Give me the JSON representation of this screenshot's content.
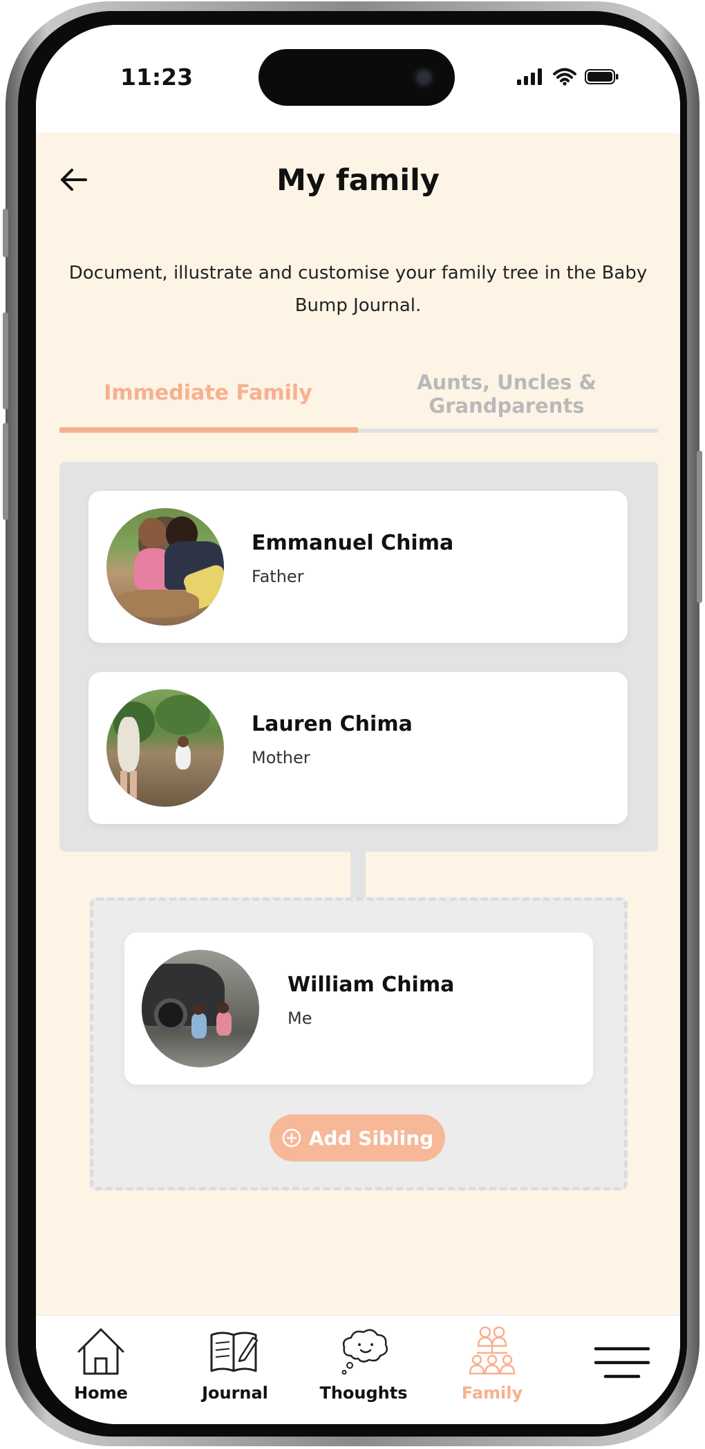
{
  "status_bar": {
    "time": "11:23"
  },
  "header": {
    "title": "My family"
  },
  "intro": "Document, illustrate and customise your family tree in the Baby Bump Journal.",
  "tabs": [
    {
      "label": "Immediate Family",
      "active": true
    },
    {
      "label": "Aunts, Uncles & Grandparents",
      "active": false
    }
  ],
  "parents": [
    {
      "name": "Emmanuel Chima",
      "role": "Father"
    },
    {
      "name": "Lauren Chima",
      "role": "Mother"
    }
  ],
  "me": {
    "name": "William Chima",
    "role": "Me"
  },
  "add_sibling_label": "Add Sibling",
  "nav": [
    {
      "label": "Home",
      "icon": "home-icon"
    },
    {
      "label": "Journal",
      "icon": "journal-icon"
    },
    {
      "label": "Thoughts",
      "icon": "thoughts-icon"
    },
    {
      "label": "Family",
      "icon": "family-icon",
      "active": true
    },
    {
      "label": "",
      "icon": "menu-icon"
    }
  ],
  "colors": {
    "accent": "#f7b08e",
    "background": "#fdf4e6",
    "tab_inactive": "#b9b9b9",
    "group_bg": "#e3e3e3"
  }
}
